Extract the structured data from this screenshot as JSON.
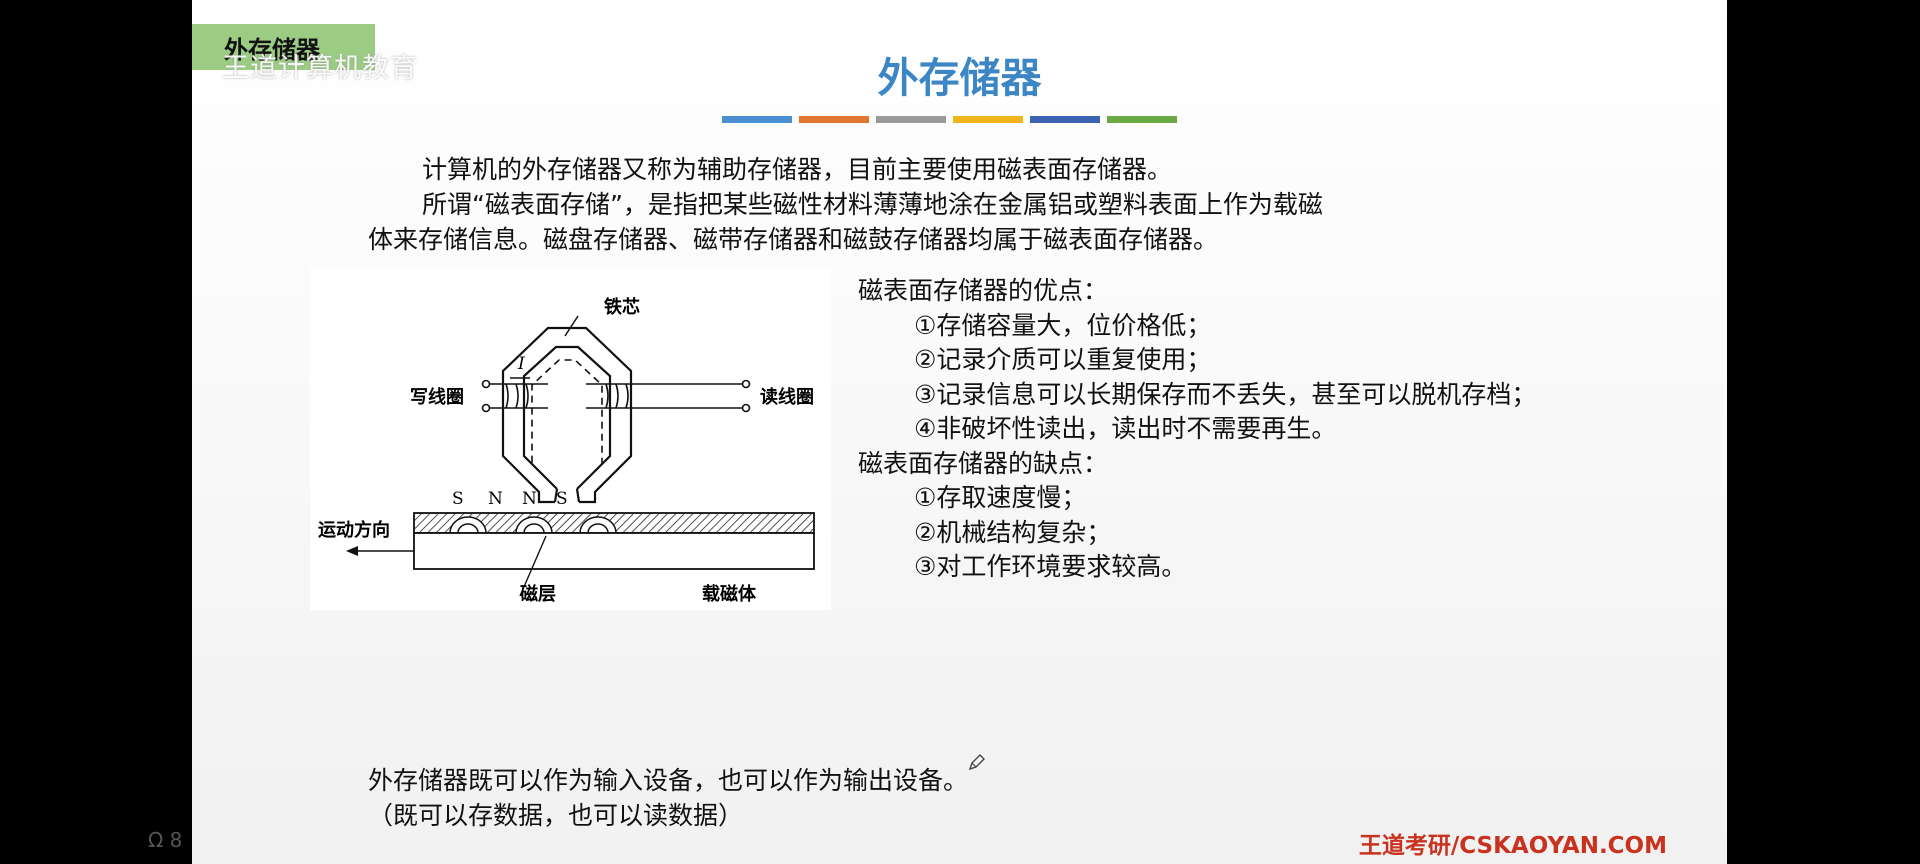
{
  "slide": {
    "section_tag": "外存储器",
    "watermark": "王道计算机教育",
    "title": "外存储器",
    "bar_colors": [
      "#4a8fd1",
      "#e0762f",
      "#9a9a9a",
      "#f2b41c",
      "#3c63b4",
      "#6aa944"
    ],
    "intro": {
      "line1": "计算机的外存储器又称为辅助存储器，目前主要使用磁表面存储器。",
      "line2": "所谓“磁表面存储”，是指把某些磁性材料薄薄地涂在金属铝或塑料表面上作为载磁",
      "line3": "体来存储信息。磁盘存储器、磁带存储器和磁鼓存储器均属于磁表面存储器。"
    },
    "figure": {
      "core_label": "铁芯",
      "current_label": "I",
      "write_coil_label": "写线圈",
      "read_coil_label": "读线圈",
      "poles": [
        "S",
        "N",
        "N",
        "S"
      ],
      "motion_label": "运动方向",
      "layer_label": "磁层",
      "carrier_label": "载磁体"
    },
    "advantages_heading": "磁表面存储器的优点：",
    "advantages": [
      "①存储容量大，位价格低；",
      "②记录介质可以重复使用；",
      "③记录信息可以长期保存而不丢失，甚至可以脱机存档；",
      "④非破坏性读出，读出时不需要再生。"
    ],
    "disadvantages_heading": "磁表面存储器的缺点：",
    "disadvantages": [
      "①存取速度慢；",
      "②机械结构复杂；",
      "③对工作环境要求较高。"
    ],
    "bottom": {
      "line1": "外存储器既可以作为输入设备，也可以作为输出设备。",
      "line2": "（既可以存数据，也可以读数据）"
    },
    "footer": "王道考研/CSKAOYAN.COM"
  },
  "player": {
    "side_indicator": "Ω 8"
  }
}
